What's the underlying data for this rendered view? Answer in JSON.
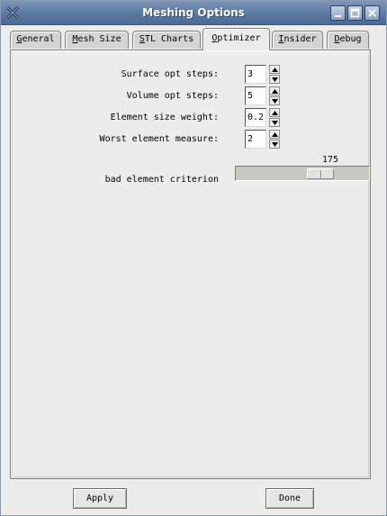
{
  "window": {
    "title": "Meshing Options",
    "icon": "x-app-icon",
    "controls": [
      "minimize-icon",
      "maximize-icon",
      "close-icon"
    ]
  },
  "tabs": [
    {
      "label": "General",
      "mnemonic": "G",
      "rest": "eneral",
      "active": false
    },
    {
      "label": "Mesh Size",
      "mnemonic": "M",
      "rest": "esh Size",
      "active": false
    },
    {
      "label": "STL Charts",
      "mnemonic": "S",
      "rest": "TL Charts",
      "active": false
    },
    {
      "label": "Optimizer",
      "mnemonic": "O",
      "rest": "ptimizer",
      "active": true
    },
    {
      "label": "Insider",
      "mnemonic": "I",
      "rest": "nsider",
      "active": false
    },
    {
      "label": "Debug",
      "mnemonic": "D",
      "rest": "ebug",
      "active": false
    }
  ],
  "optimizer": {
    "surface_opt_steps": {
      "label": "Surface opt steps:",
      "value": "3"
    },
    "volume_opt_steps": {
      "label": "Volume opt steps:",
      "value": "5"
    },
    "element_size_weight": {
      "label": "Element size weight:",
      "value": "0.2"
    },
    "worst_element_measure": {
      "label": "Worst element measure:",
      "value": "2"
    },
    "bad_element_criterion": {
      "label": "bad element criterion",
      "value": "175",
      "fraction": 0.67
    }
  },
  "buttons": {
    "apply": "Apply",
    "done": "Done"
  },
  "colors": {
    "titlebar": "#5b78a1",
    "window_bg": "#ececec",
    "slider_track": "#c6c8c0"
  }
}
